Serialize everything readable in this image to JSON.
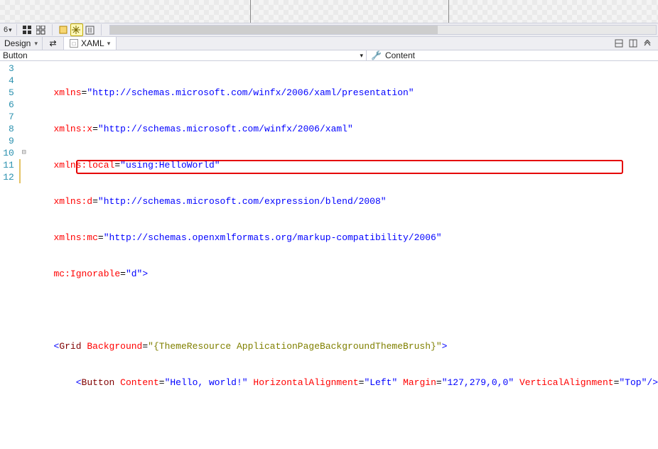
{
  "design": {
    "button_text": "Hello, world!"
  },
  "toolbar": {
    "zoom": "6"
  },
  "splitter": {
    "design_tab": "Design",
    "xaml_tab": "XAML"
  },
  "pathbar": {
    "element": "Button",
    "property_label": "Content"
  },
  "editor": {
    "line_numbers": [
      "3",
      "4",
      "5",
      "6",
      "7",
      "8",
      "9",
      "10",
      "11",
      "12"
    ],
    "lines": {
      "l3": {
        "attr": "xmlns",
        "eq": "=",
        "val": "\"http://schemas.microsoft.com/winfx/2006/xaml/presentation\""
      },
      "l4": {
        "attr": "xmlns:x",
        "eq": "=",
        "val": "\"http://schemas.microsoft.com/winfx/2006/xaml\""
      },
      "l5": {
        "attr": "xmlns:local",
        "eq": "=",
        "val": "\"using:HelloWorld\""
      },
      "l6": {
        "attr": "xmlns:d",
        "eq": "=",
        "val": "\"http://schemas.microsoft.com/expression/blend/2008\""
      },
      "l7": {
        "attr": "xmlns:mc",
        "eq": "=",
        "val": "\"http://schemas.openxmlformats.org/markup-compatibility/2006\""
      },
      "l8": {
        "attr": "mc:Ignorable",
        "eq": "=",
        "val": "\"d\"",
        "close": ">"
      },
      "l10": {
        "open": "<",
        "tag": "Grid",
        "sp": " ",
        "a1": "Background",
        "eq": "=",
        "v1": "\"{ThemeResource ApplicationPageBackgroundThemeBrush}\"",
        "close": ">"
      },
      "l11": {
        "open": "<",
        "tag": "Button",
        "sp": " ",
        "a1": "Content",
        "eq1": "=",
        "v1": "\"Hello, world!\"",
        "a2": "HorizontalAlignment",
        "eq2": "=",
        "v2": "\"Left\"",
        "a3": "Margin",
        "eq3": "=",
        "v3": "\"127,279,0,0\"",
        "a4": "VerticalAlignment",
        "eq4": "=",
        "v4": "\"Top\"",
        "close": "/>"
      }
    }
  }
}
